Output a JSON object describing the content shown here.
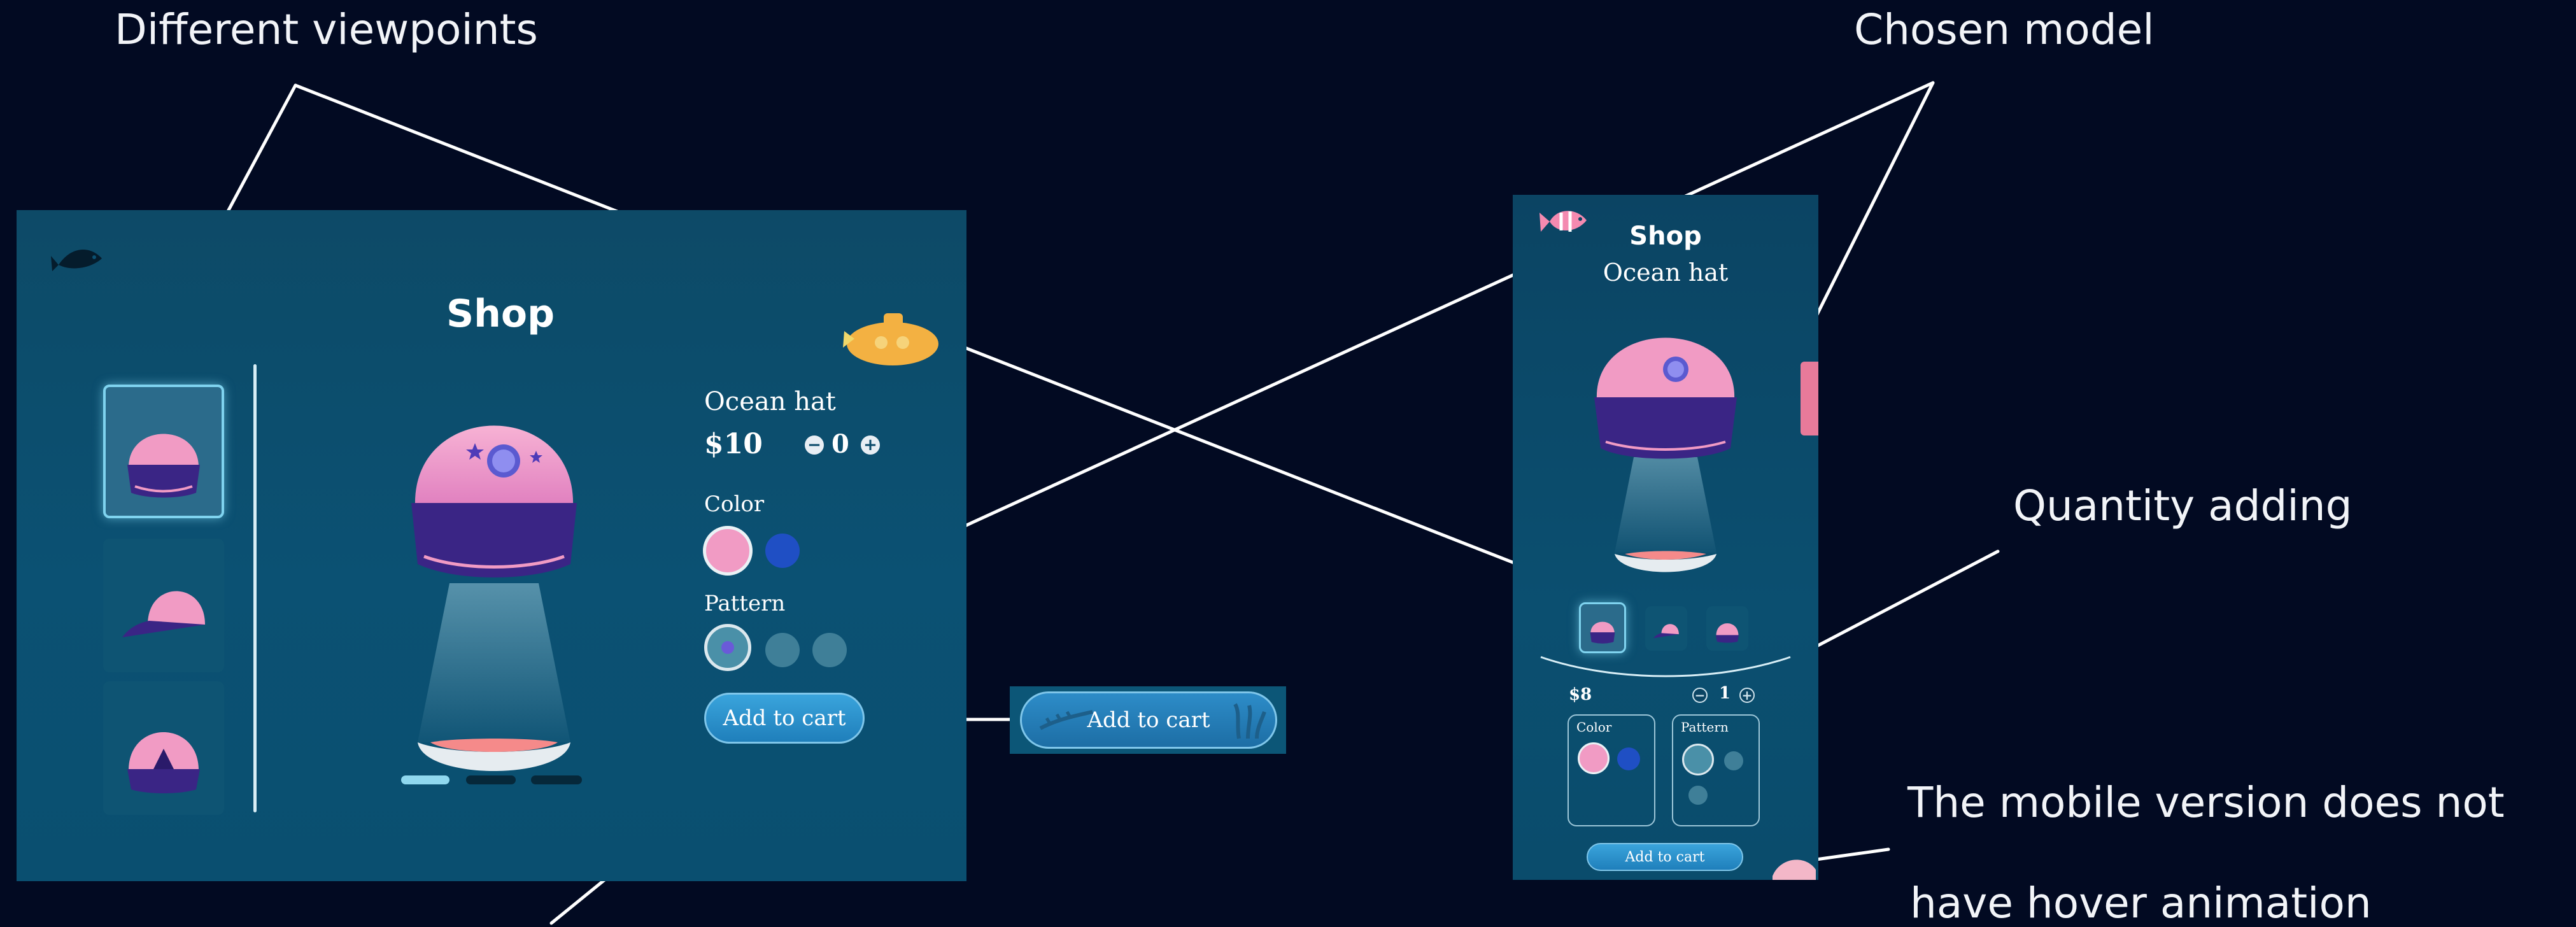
{
  "annotations": {
    "viewpoints": "Different viewpoints",
    "chosen_model": "Chosen model",
    "quantity_adding": "Quantity adding",
    "mobile_note_line1": "The mobile version does not",
    "mobile_note_line2": "have hover animation"
  },
  "desktop": {
    "title": "Shop",
    "product_name": "Ocean hat",
    "price": "$10",
    "quantity": "0",
    "color_label": "Color",
    "pattern_label": "Pattern",
    "add_to_cart": "Add to cart",
    "add_to_cart_hover": "Add to cart",
    "colors": [
      "#f19bc4",
      "#1f4fc4"
    ],
    "thumbnails": [
      "front-view",
      "side-view",
      "back-view"
    ],
    "carousel_active_index": 0
  },
  "mobile": {
    "title": "Shop",
    "product_name": "Ocean hat",
    "price": "$8",
    "quantity": "1",
    "color_label": "Color",
    "pattern_label": "Pattern",
    "add_to_cart": "Add to cart",
    "colors": [
      "#f19bc4",
      "#1f4fc4"
    ]
  },
  "icons": {
    "fish": "fish-icon",
    "submarine": "submarine-icon",
    "hat": "cap-icon",
    "shell": "shell-icon",
    "fish_logo": "fish-logo-icon"
  },
  "colors": {
    "background": "#020a22",
    "panel": "#0b5173",
    "hat_pink": "#f19bc4",
    "hat_brim": "#3a2585",
    "accent_blue": "#2a8fd0"
  }
}
